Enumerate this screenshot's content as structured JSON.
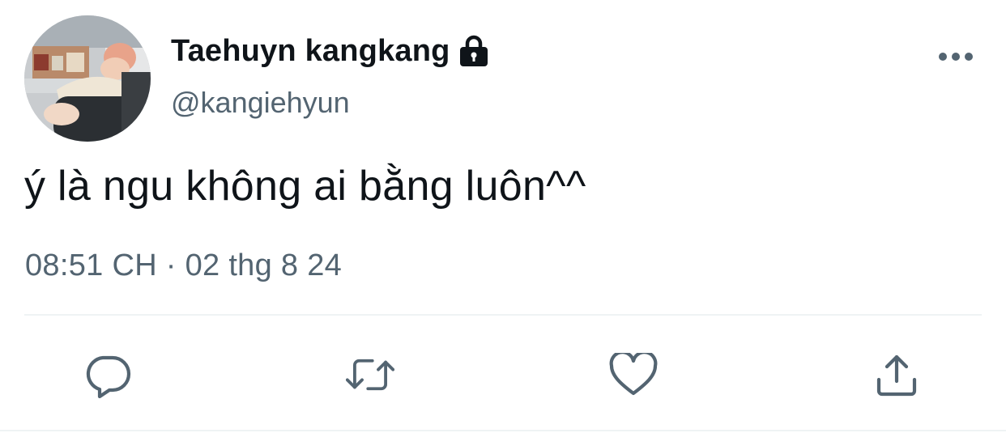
{
  "tweet": {
    "display_name": "Taehuyn kangkang",
    "handle": "@kangiehyun",
    "protected_icon": "lock-icon",
    "more_icon": "more-dots-icon",
    "text": "ý là ngu không ai bằng luôn^^",
    "timestamp": "08:51 CH · 02 thg 8 24"
  },
  "actions": [
    {
      "name": "reply",
      "icon": "reply-icon"
    },
    {
      "name": "retweet",
      "icon": "retweet-icon"
    },
    {
      "name": "like",
      "icon": "heart-icon"
    },
    {
      "name": "share",
      "icon": "share-icon"
    }
  ],
  "colors": {
    "text_primary": "#0f1419",
    "text_secondary": "#536471",
    "icon": "#536471",
    "divider": "#eff3f4"
  }
}
